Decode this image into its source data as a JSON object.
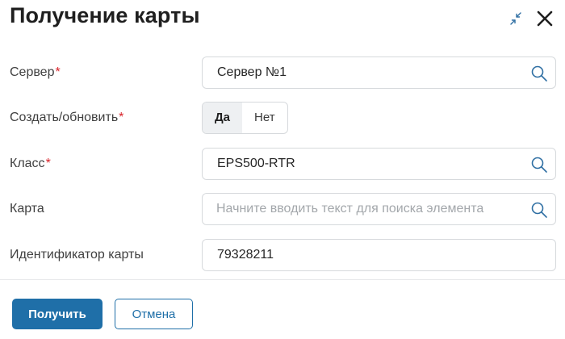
{
  "dialog": {
    "title": "Получение карты",
    "icons": {
      "collapse": "collapse-arrows-icon",
      "close": "close-icon"
    }
  },
  "form": {
    "server": {
      "label": "Сервер",
      "required_mark": "*",
      "value": "Сервер №1",
      "icon": "search-icon"
    },
    "create_update": {
      "label": "Создать/обновить",
      "required_mark": "*",
      "options": [
        "Да",
        "Нет"
      ],
      "selected": "Да"
    },
    "class": {
      "label": "Класс",
      "required_mark": "*",
      "value": "EPS500-RTR",
      "icon": "search-icon"
    },
    "card": {
      "label": "Карта",
      "placeholder": "Начните вводить текст для поиска элемента",
      "icon": "search-icon"
    },
    "card_id": {
      "label": "Идентификатор карты",
      "value": "79328211"
    }
  },
  "footer": {
    "submit_label": "Получить",
    "cancel_label": "Отмена"
  },
  "colors": {
    "primary": "#1f6fa8",
    "required": "#d8232a",
    "border": "#d6d9dc",
    "toggle_active_bg": "#eef0f2"
  }
}
